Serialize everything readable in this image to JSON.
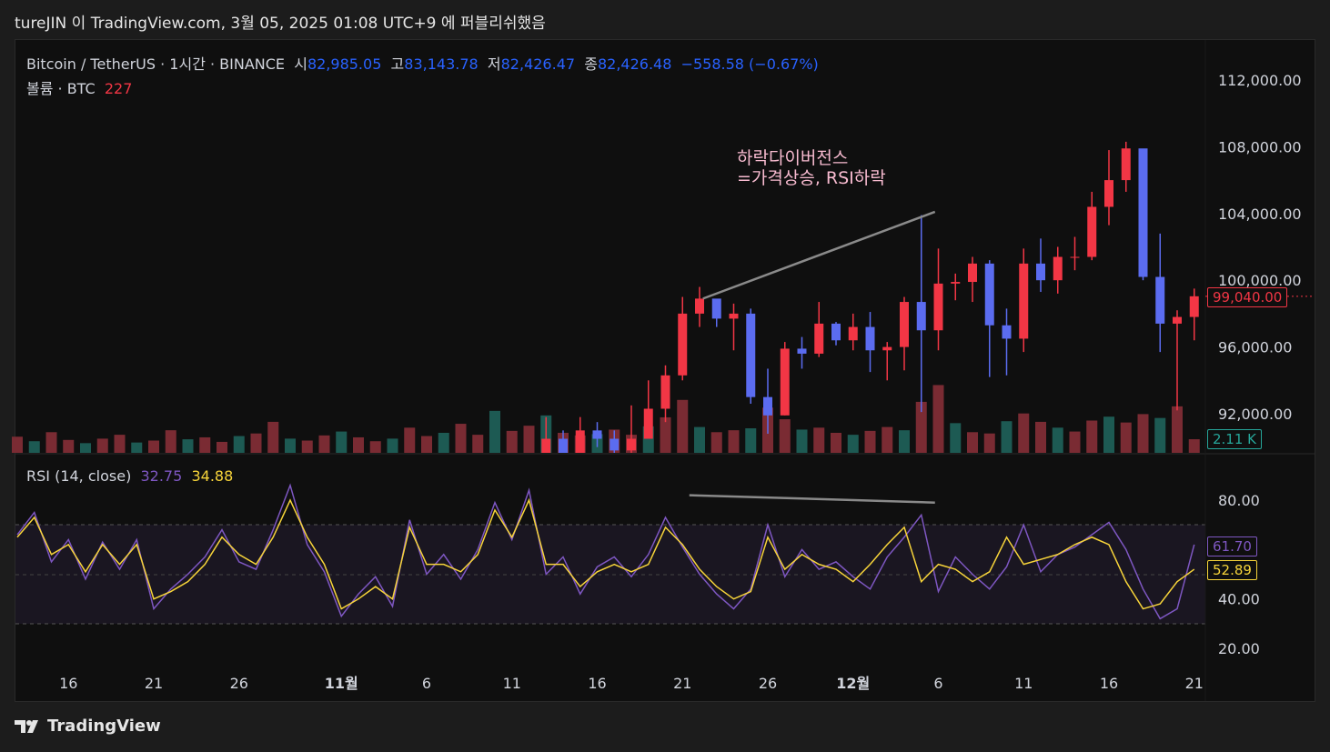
{
  "header": {
    "published": "tureJIN 이 TradingView.com, 3월 05, 2025 01:08 UTC+9 에 퍼블리쉬했음"
  },
  "legend": {
    "symbol": "Bitcoin / TetherUS · 1시간 · BINANCE",
    "open_label": "시",
    "open": "82,985.05",
    "high_label": "고",
    "high": "83,143.78",
    "low_label": "저",
    "low": "82,426.47",
    "close_label": "종",
    "close": "82,426.48",
    "change": "−558.58 (−0.67%)",
    "volume_label": "볼륨 · BTC",
    "volume": "227",
    "rsi_label": "RSI (14, close)",
    "rsi_value": "32.75",
    "rsi_ma_value": "34.88"
  },
  "annotation": {
    "line1": "하락다이버전스",
    "line2": "=가격상승, RSI하락"
  },
  "price_tags": {
    "last_price": "99,040.00",
    "volume": "2.11 K",
    "rsi": "61.70",
    "rsi_ma": "52.89"
  },
  "footer": {
    "logo_text": "TradingView"
  },
  "colors": {
    "up": "#f23645",
    "down": "#5b6cf0",
    "vol_up": "#7a2b33",
    "vol_down": "#1d5a53",
    "rsi": "#7e57c2",
    "rsi_ma": "#f7d43a",
    "annotation": "#f8bbd0"
  },
  "chart_data": {
    "type": "candlestick",
    "title": "Bitcoin / TetherUS · 1시간 · BINANCE",
    "x_start": "Oct 13",
    "x_ticks": [
      {
        "day": 3,
        "label": "16"
      },
      {
        "day": 8,
        "label": "21"
      },
      {
        "day": 13,
        "label": "26"
      },
      {
        "day": 19,
        "label": "11월"
      },
      {
        "day": 24,
        "label": "6"
      },
      {
        "day": 29,
        "label": "11"
      },
      {
        "day": 34,
        "label": "16"
      },
      {
        "day": 39,
        "label": "21"
      },
      {
        "day": 44,
        "label": "26"
      },
      {
        "day": 49,
        "label": "12월"
      },
      {
        "day": 54,
        "label": "6"
      },
      {
        "day": 59,
        "label": "11"
      },
      {
        "day": 64,
        "label": "16"
      },
      {
        "day": 69,
        "label": "21"
      }
    ],
    "price_axis": {
      "ticks": [
        "112,000.00",
        "108,000.00",
        "104,000.00",
        "100,000.00",
        "96,000.00",
        "92,000.00"
      ],
      "tick_values": [
        112000,
        108000,
        104000,
        100000,
        96000,
        92000
      ],
      "ylim": [
        89600,
        113000
      ]
    },
    "candles_start_day": 30,
    "close": [
      88000,
      90500,
      87500,
      91000,
      90500,
      89800,
      90500,
      92300,
      94300,
      98000,
      98900,
      97700,
      98000,
      93000,
      91900,
      95900,
      95600,
      97400,
      96400,
      97200,
      95800,
      96000,
      98700,
      97000,
      99800,
      99900,
      101000,
      97300,
      96500,
      101000,
      100000,
      101400,
      101400,
      104400,
      106000,
      107900,
      100200,
      97400,
      97800,
      99040
    ],
    "high": [
      89500,
      91800,
      91000,
      91800,
      91500,
      91000,
      92500,
      94000,
      94900,
      99000,
      99600,
      98800,
      98600,
      98300,
      94700,
      96300,
      96600,
      98700,
      97500,
      98000,
      98100,
      96300,
      99000,
      103900,
      101900,
      100400,
      101400,
      101200,
      98300,
      101900,
      102500,
      102000,
      102600,
      105300,
      107800,
      108300,
      106500,
      102800,
      98200,
      99500
    ],
    "low": [
      85500,
      86800,
      86700,
      87100,
      90000,
      89300,
      89400,
      90800,
      91500,
      94000,
      97200,
      97200,
      95800,
      92600,
      90800,
      91900,
      94700,
      95400,
      96100,
      95800,
      94500,
      94000,
      94600,
      92100,
      95800,
      98800,
      98700,
      94200,
      94300,
      95700,
      99300,
      99200,
      100600,
      101200,
      103300,
      105300,
      100000,
      95700,
      92200,
      96400
    ],
    "open_first": 86500,
    "volume_k": [
      2.5,
      1.8,
      3.2,
      2.0,
      1.5,
      2.2,
      2.8,
      1.6,
      1.9,
      3.5,
      2.1,
      2.4,
      1.7,
      2.6,
      3.0,
      4.8,
      2.2,
      1.9,
      2.7,
      3.3,
      2.4,
      1.8,
      2.2,
      3.9,
      2.6,
      3.1,
      4.5,
      2.8,
      6.5,
      3.4,
      4.2,
      5.8,
      3.1,
      2.7,
      2.9,
      3.6,
      2.8,
      4.1,
      5.5,
      8.2,
      4.0,
      3.2,
      3.5,
      3.8,
      7.0,
      5.2,
      3.6,
      3.9,
      3.1,
      2.8,
      3.4,
      4.0,
      3.5,
      7.9,
      10.5,
      4.6,
      3.2,
      3.0,
      4.9,
      6.1,
      4.8,
      3.9,
      3.3,
      5.0,
      5.6,
      4.7,
      6.0,
      5.4,
      7.2,
      2.11
    ],
    "rsi_axis": {
      "ticks": [
        "80.00",
        "40.00",
        "20.00"
      ],
      "tick_values": [
        80,
        40,
        20
      ],
      "bands": [
        70,
        50,
        30
      ],
      "ylim": [
        15,
        88
      ]
    },
    "rsi": [
      66,
      75,
      55,
      64,
      48,
      63,
      52,
      64,
      36,
      44,
      50,
      57,
      68,
      55,
      52,
      68,
      86,
      62,
      51,
      33,
      42,
      49,
      37,
      72,
      50,
      58,
      48,
      60,
      79,
      64,
      84,
      50,
      57,
      42,
      53,
      57,
      49,
      58,
      73,
      61,
      50,
      42,
      36,
      44,
      70,
      49,
      60,
      52,
      55,
      49,
      44,
      57,
      65,
      74,
      43,
      57,
      50,
      44,
      53,
      70,
      51,
      58,
      61,
      66,
      71,
      60,
      44,
      32,
      36,
      62
    ],
    "rsi_ma": [
      65,
      73,
      58,
      62,
      51,
      62,
      54,
      62,
      40,
      43,
      47,
      54,
      65,
      58,
      54,
      65,
      80,
      65,
      54,
      36,
      40,
      45,
      40,
      69,
      54,
      54,
      51,
      58,
      76,
      65,
      80,
      54,
      54,
      45,
      51,
      54,
      51,
      54,
      69,
      62,
      52,
      45,
      40,
      43,
      65,
      52,
      58,
      54,
      52,
      47,
      54,
      62,
      69,
      47,
      54,
      52,
      47,
      51,
      65,
      54,
      56,
      58,
      62,
      65,
      62,
      47,
      36,
      38,
      47,
      52
    ],
    "series": [
      {
        "name": "RSI"
      },
      {
        "name": "RSI MA"
      }
    ],
    "trendlines": [
      {
        "pane": "price",
        "from": {
          "day": 40.2,
          "value": 98900
        },
        "to": {
          "day": 53.8,
          "value": 104100
        }
      },
      {
        "pane": "rsi",
        "from": {
          "day": 39.4,
          "value": 82
        },
        "to": {
          "day": 53.8,
          "value": 79
        }
      }
    ]
  }
}
